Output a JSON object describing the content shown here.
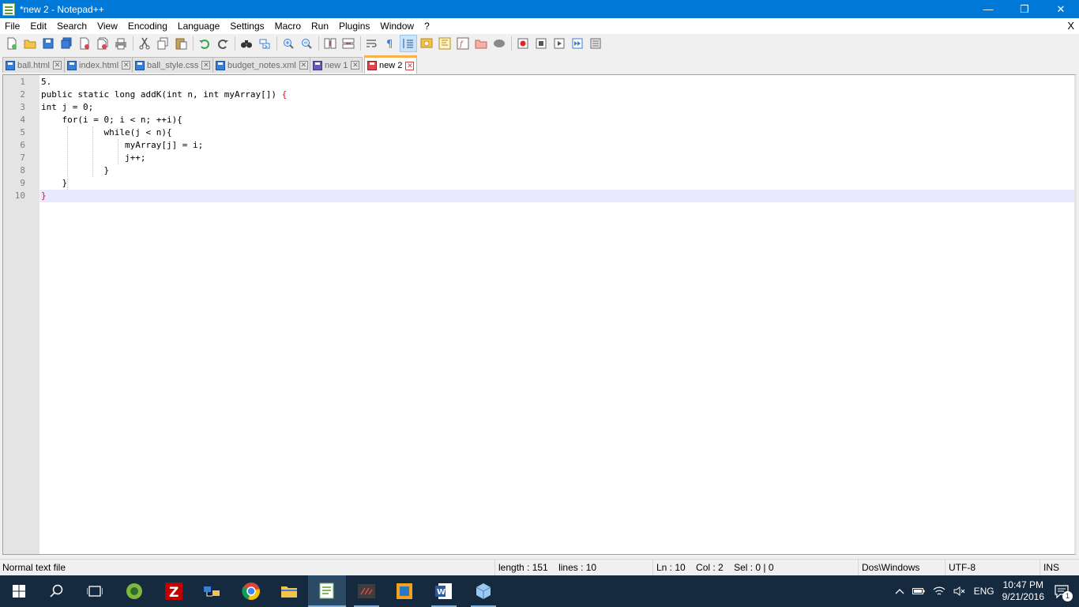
{
  "window": {
    "title": "*new 2 - Notepad++",
    "minimize_glyph": "—",
    "restore_glyph": "❐",
    "close_glyph": "✕"
  },
  "menu": {
    "items": [
      "File",
      "Edit",
      "Search",
      "View",
      "Encoding",
      "Language",
      "Settings",
      "Macro",
      "Run",
      "Plugins",
      "Window",
      "?"
    ],
    "close_glyph": "X"
  },
  "toolbar": {
    "buttons": [
      "new-file",
      "open-file",
      "save",
      "save-all",
      "close",
      "close-all",
      "print",
      "cut",
      "copy",
      "paste",
      "undo",
      "redo",
      "find",
      "replace",
      "zoom-in",
      "zoom-out",
      "sync-vertical",
      "sync-horizontal",
      "word-wrap",
      "show-all-characters",
      "indent-guide",
      "user-defined-language",
      "doc-map",
      "function-list",
      "folder-as-workspace",
      "monitoring",
      "record-macro",
      "stop-recording",
      "play-macro",
      "run-macro-multiple",
      "save-macro"
    ],
    "active_button": "indent-guide"
  },
  "tabs": [
    {
      "label": "ball.html",
      "icon": "saved-file-icon",
      "active": false
    },
    {
      "label": "index.html",
      "icon": "saved-file-icon",
      "active": false
    },
    {
      "label": "ball_style.css",
      "icon": "saved-file-icon",
      "active": false
    },
    {
      "label": "budget_notes.xml",
      "icon": "saved-file-icon",
      "active": false
    },
    {
      "label": "new 1",
      "icon": "unsaved-file-icon",
      "active": false
    },
    {
      "label": "new 2",
      "icon": "modified-file-icon",
      "active": true
    }
  ],
  "editor": {
    "line_numbers": [
      "1",
      "2",
      "3",
      "4",
      "5",
      "6",
      "7",
      "8",
      "9",
      "10"
    ],
    "lines": [
      "5.",
      "public static long addK(int n, int myArray[]) ",
      "int j = 0;",
      "    for(i = 0; i < n; ++i){",
      "            while(j < n){",
      "                myArray[j] = i;",
      "                j++;",
      "            }",
      "    }",
      ""
    ],
    "brace_open": "{",
    "brace_close": "}",
    "current_line": 10
  },
  "status": {
    "file_type": "Normal text file",
    "length": "length : 151",
    "lines": "lines : 10",
    "ln": "Ln : 10",
    "col": "Col : 2",
    "sel": "Sel : 0 | 0",
    "eol": "Dos\\Windows",
    "encoding": "UTF-8",
    "mode": "INS"
  },
  "taskbar": {
    "apps": [
      "start",
      "search",
      "task-view",
      "android-studio",
      "filezilla",
      "network-app",
      "chrome",
      "file-explorer",
      "notepad-plus-plus",
      "terminal-app",
      "windows-app",
      "word",
      "3d-app"
    ],
    "active_app": "notepad-plus-plus",
    "language": "ENG",
    "time": "10:47 PM",
    "date": "9/21/2016",
    "notification_count": "1"
  },
  "colors": {
    "titlebar": "#0078d7",
    "taskbar": "#162a3f",
    "current_line": "#e8e8ff",
    "brace_highlight": "#ff0000",
    "active_tab_accent": "#fab04b"
  }
}
